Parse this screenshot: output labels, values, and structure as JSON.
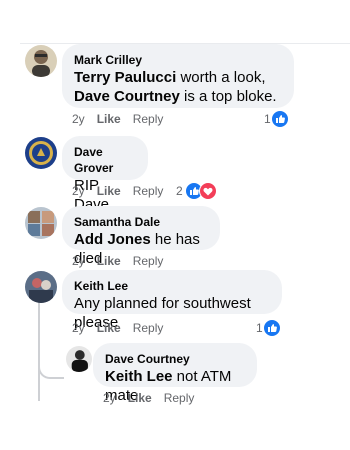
{
  "comments": [
    {
      "author": "Mark Crilley",
      "parts": [
        "Terry Paulucci",
        " worth a look, ",
        "Dave Courtney",
        " is a top bloke."
      ],
      "time": "2y",
      "like": "Like",
      "reply": "Reply",
      "reaction_count": "1"
    },
    {
      "author": "Dave Grover",
      "text": "RIP Dave",
      "time": "2y",
      "like": "Like",
      "reply": "Reply",
      "reaction_count": "2"
    },
    {
      "author": "Samantha Dale",
      "parts": [
        "Add Jones",
        " he has died"
      ],
      "time": "2y",
      "like": "Like",
      "reply": "Reply"
    },
    {
      "author": "Keith Lee",
      "text": "Any planned for southwest please",
      "time": "2y",
      "like": "Like",
      "reply": "Reply",
      "reaction_count": "1"
    },
    {
      "author": "Dave Courtney",
      "parts": [
        "Keith Lee",
        " not ATM mate"
      ],
      "time": "2y",
      "like": "Like",
      "reply": "Reply"
    }
  ],
  "colors": {
    "bubble": "#f0f2f5",
    "like_blue": "#1877f2",
    "love_red": "#f33e58",
    "meta": "#65676b"
  },
  "icons": [
    "like-icon",
    "love-icon"
  ]
}
